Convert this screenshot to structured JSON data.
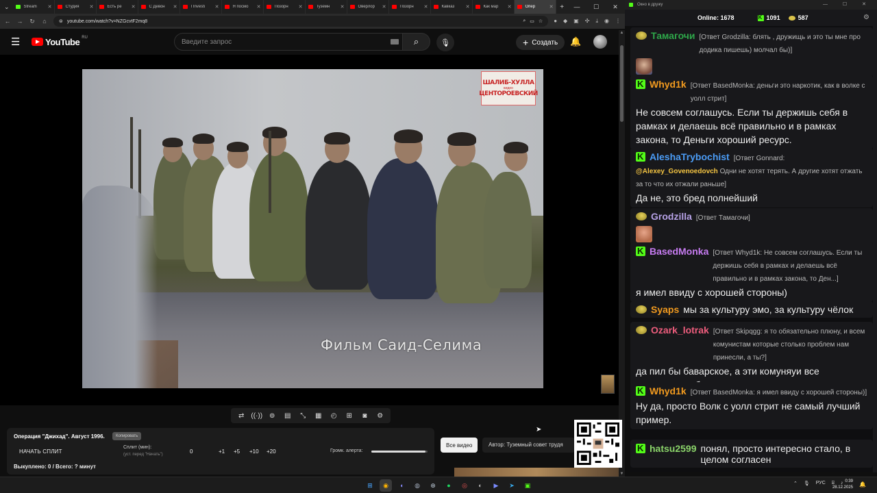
{
  "browser": {
    "tabs": [
      {
        "label": "Stream",
        "favicon": "kick",
        "active": false
      },
      {
        "label": "Студия",
        "favicon": "youtube",
        "active": false
      },
      {
        "label": "Есть ре",
        "favicon": "youtube",
        "active": false
      },
      {
        "label": "С Девон",
        "favicon": "youtube",
        "active": false
      },
      {
        "label": "I Investi",
        "favicon": "youtube",
        "active": false
      },
      {
        "label": "Я посмо",
        "favicon": "youtube",
        "active": false
      },
      {
        "label": "Позорн",
        "favicon": "youtube",
        "active": false
      },
      {
        "label": "Туземн",
        "favicon": "youtube",
        "active": false
      },
      {
        "label": "Оверлор",
        "favicon": "youtube",
        "active": false
      },
      {
        "label": "Позорн",
        "favicon": "youtube",
        "active": false
      },
      {
        "label": "Кавказ",
        "favicon": "youtube",
        "active": false
      },
      {
        "label": "Как мар",
        "favicon": "youtube",
        "active": false
      },
      {
        "label": "Опер",
        "favicon": "youtube",
        "active": true
      }
    ],
    "url": "youtube.com/watch?v=NZGcvtF2mq8"
  },
  "youtube": {
    "logo_text": "YouTube",
    "region": "RU",
    "search_placeholder": "Введите запрос",
    "create_label": "Создать"
  },
  "video": {
    "watermark_top": "ШАЛИБ-ХУЛЛА",
    "watermark_mid": "видео",
    "watermark_bottom": "ЦЕНТОРОЕВСКИЙ",
    "subtitle": "Фильм  Саид-Селима"
  },
  "split_panel": {
    "title": "Операция \"Джихад\". Август 1996.",
    "chip": "Копировать",
    "start_label": "НАЧАТЬ СПЛИТ",
    "split_label": "Сплит (мин):",
    "split_hint": "(уст. перед \"Начать\")",
    "split_value": "0",
    "increments": [
      "+1",
      "+5",
      "+10",
      "+20"
    ],
    "alert_volume_label": "Громк. алерта:",
    "alert_volume_fraction": 0.96,
    "footer": "Выкуплено: 0 / Всего: ? минут"
  },
  "all_video_label": "Все видео",
  "author_label": "Автор: Туземный совет трудя",
  "chat_header": {
    "window_title": "Окно в дружу",
    "online_label": "Online:",
    "online_count": "1678",
    "kick_count": "1091",
    "bee_count": "587"
  },
  "colors": {
    "kick_green": "#53fc18",
    "youtube_red": "#ff0000",
    "chat_bg": "#18181b"
  },
  "chat": [
    {
      "user": "Тамагочи",
      "color": "#2ea84a",
      "badge": "bee",
      "reply": "[Ответ Grodzilla: блять , дружищь и это ты мне про додика пишешь) молчал бы)]",
      "text": "",
      "emote": true
    },
    {
      "user": "Whyd1k",
      "color": "#f39b1f",
      "badge": "kick",
      "reply": "[Ответ BasedMonka: деньги это наркотик, как в волке с уолл стрит]",
      "text": "Не совсем соглашусь. Если ты держишь себя в рамках и делаешь всё правильно и в рамках закона, то Деньги хороший ресурс."
    },
    {
      "user": "AleshaTrybochist",
      "color": "#4b9cf5",
      "badge": "kick",
      "reply_prefix": "[Ответ Gonnard:",
      "mention": "@Alexey_Govenoedovch",
      "reply": "Одни не хотят терять. А другие хотят отжать за то что их отжали раньше]",
      "text": "Да не, это бред полнейший"
    },
    {
      "user": "Grodzilla",
      "color": "#b8a3e8",
      "badge": "bee",
      "reply": "[Ответ Тамагочи]",
      "text": "",
      "emote": true
    },
    {
      "user": "BasedMonka",
      "color": "#c77cf2",
      "badge": "kick",
      "reply": "[Ответ Whyd1k: Не совсем соглашусь. Если ты держишь себя в рамках и делаешь всё правильно и в рамках закона, то Ден...]",
      "text": "я имел ввиду с хорошей стороны)"
    },
    {
      "user": "Syaps",
      "color": "#f39b1f",
      "badge": "bee",
      "reply": "",
      "text": "мы за культуру эмо, за культуру чёлок"
    },
    {
      "user": "Ozark_lotrak",
      "color": "#ee5d7d",
      "badge": "bee",
      "reply": "[Ответ Skipqgg: я то обязательно плюну, и всем комунистам которые столько проблем нам принесли, а ты?]",
      "text": "да пил бы баварское, а эти комуняуи все попортили тебе."
    },
    {
      "user": "Whyd1k",
      "color": "#f39b1f",
      "badge": "kick",
      "reply": "[Ответ BasedMonka: я имел ввиду с хорошей стороны)]",
      "text": "Ну да, просто Волк с уолл стрит не самый лучший пример."
    },
    {
      "user": "hatsu2599",
      "color": "#8bd46a",
      "badge": "kick",
      "reply": "",
      "text": "понял, просто интересно стало, в целом согласен"
    }
  ],
  "taskbar": {
    "tray_lang": "РУС",
    "time": "0:39",
    "date": "28.12.2025"
  }
}
